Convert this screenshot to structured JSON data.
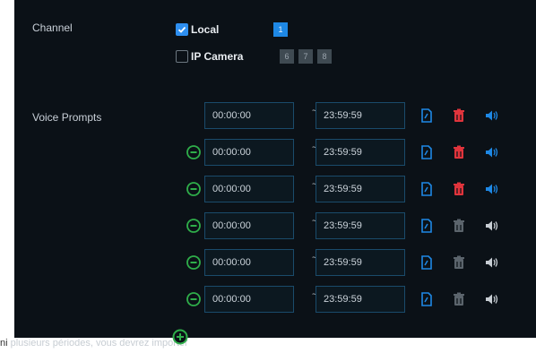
{
  "channel": {
    "label": "Channel",
    "local_label": "Local",
    "local_checked": true,
    "local_channels": [
      "1"
    ],
    "ip_camera_label": "IP Camera",
    "ip_camera_checked": false,
    "ip_camera_channels": [
      "6",
      "7",
      "8"
    ]
  },
  "voice_prompts": {
    "label": "Voice Prompts",
    "separator": "~",
    "rows": [
      {
        "start": "00:00:00",
        "end": "23:59:59",
        "has_remove": false,
        "delete_active": true,
        "audio_active": true
      },
      {
        "start": "00:00:00",
        "end": "23:59:59",
        "has_remove": true,
        "delete_active": true,
        "audio_active": true
      },
      {
        "start": "00:00:00",
        "end": "23:59:59",
        "has_remove": true,
        "delete_active": true,
        "audio_active": true
      },
      {
        "start": "00:00:00",
        "end": "23:59:59",
        "has_remove": true,
        "delete_active": false,
        "audio_active": false
      },
      {
        "start": "00:00:00",
        "end": "23:59:59",
        "has_remove": true,
        "delete_active": false,
        "audio_active": false
      },
      {
        "start": "00:00:00",
        "end": "23:59:59",
        "has_remove": true,
        "delete_active": false,
        "audio_active": false
      }
    ]
  },
  "footer": {
    "text_prefix": "ni",
    "text_rest": "plusieurs périodes, vous devrez importer"
  },
  "colors": {
    "panel_bg": "#0b1117",
    "accent_blue": "#1e88e5",
    "delete_red": "#e0343c",
    "remove_green": "#2fae4a",
    "inactive_grey": "#5b646c"
  },
  "icons": {
    "remove": "remove-circle-icon",
    "add": "add-circle-icon",
    "file": "file-icon",
    "delete": "trash-icon",
    "audio": "speaker-icon",
    "check": "check-icon"
  }
}
